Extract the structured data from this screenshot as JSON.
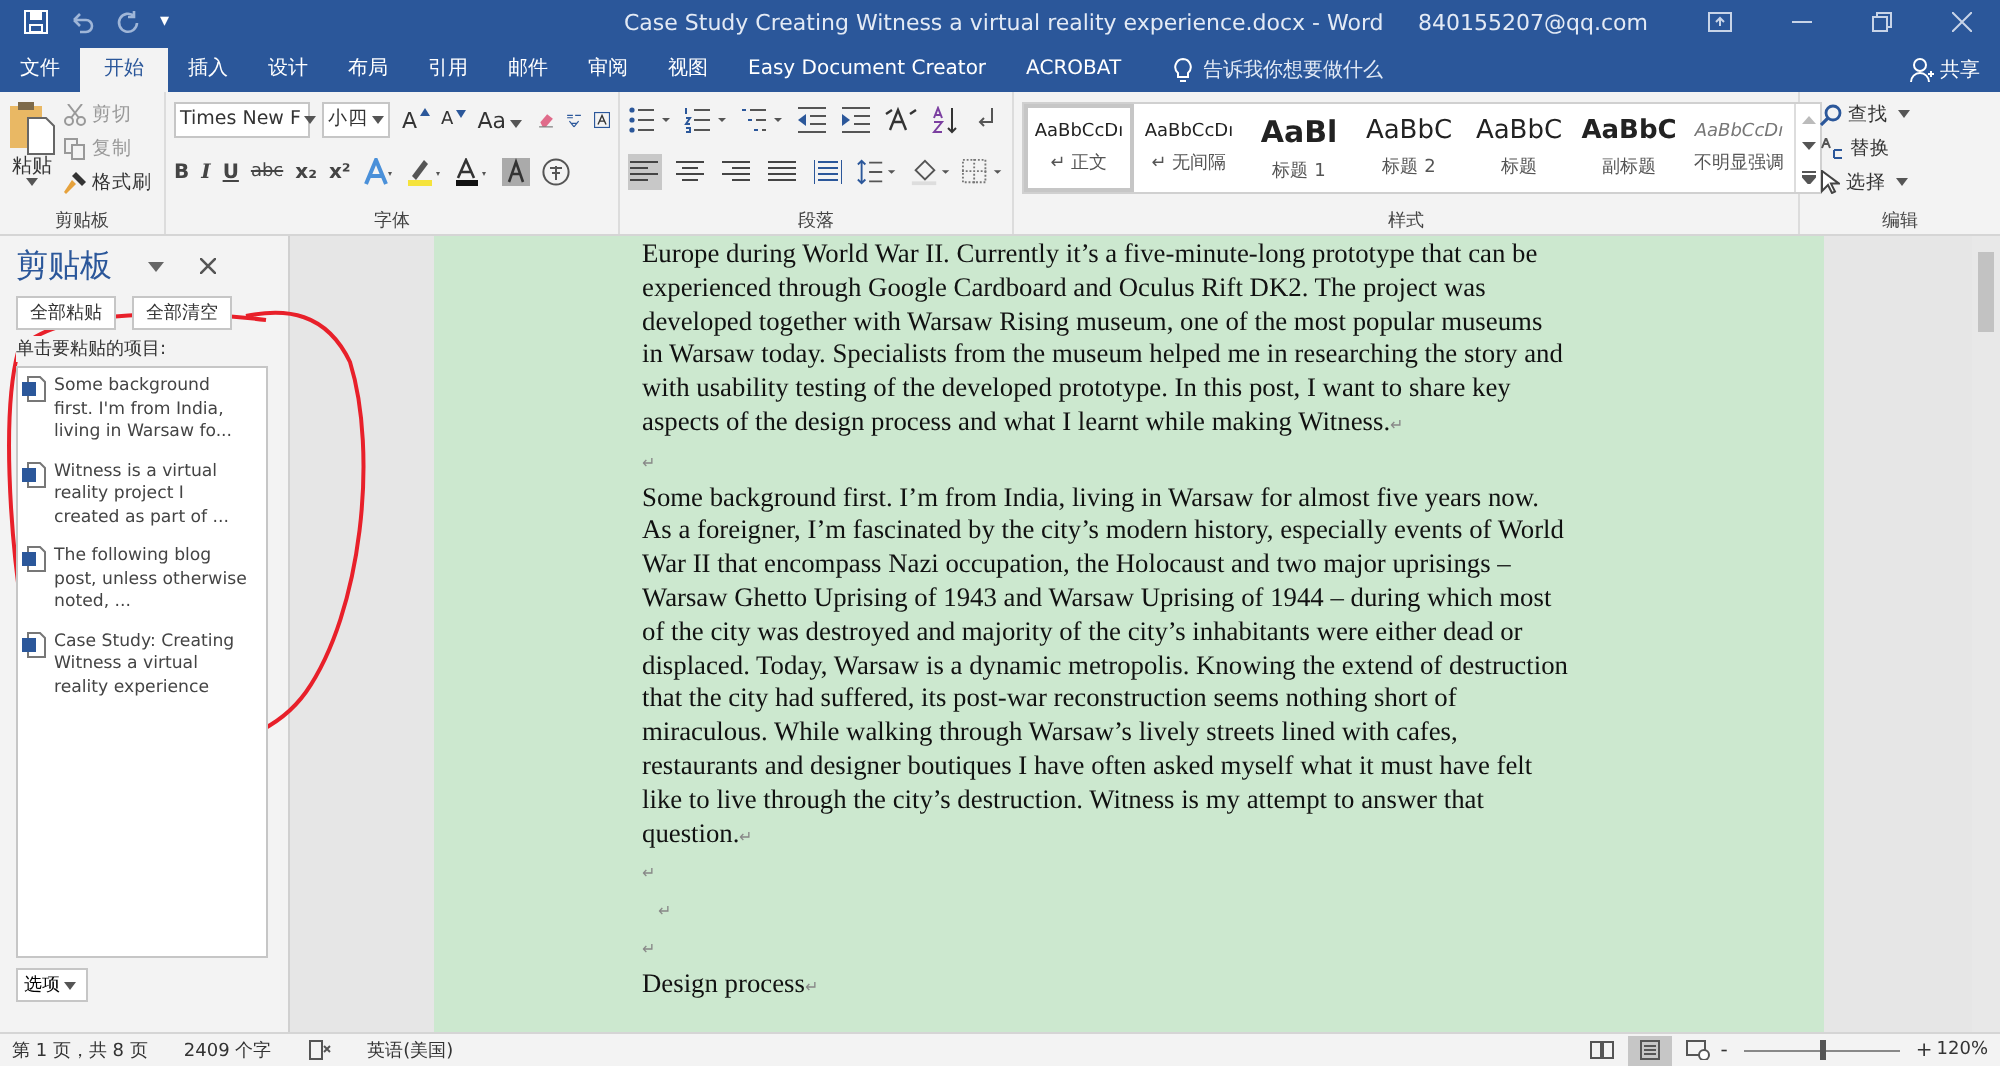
{
  "title_bar": {
    "title": "Case Study Creating Witness a virtual reality experience.docx  -  Word",
    "account": "840155207@qq.com",
    "customize": "▾"
  },
  "tabs": [
    {
      "label": "文件",
      "selected": false
    },
    {
      "label": "开始",
      "selected": true
    },
    {
      "label": "插入",
      "selected": false
    },
    {
      "label": "设计",
      "selected": false
    },
    {
      "label": "布局",
      "selected": false
    },
    {
      "label": "引用",
      "selected": false
    },
    {
      "label": "邮件",
      "selected": false
    },
    {
      "label": "审阅",
      "selected": false
    },
    {
      "label": "视图",
      "selected": false
    },
    {
      "label": "Easy Document Creator",
      "selected": false
    },
    {
      "label": "ACROBAT",
      "selected": false
    }
  ],
  "tell_me": {
    "placeholder": "告诉我你想要做什么"
  },
  "share": "共享",
  "ribbon": {
    "clipboard": {
      "paste": "粘贴",
      "cut": "剪切",
      "copy": "复制",
      "format_painter": "格式刷",
      "label": "剪贴板"
    },
    "font": {
      "font_name": "Times New F",
      "font_size": "小四",
      "grow": "A",
      "shrink": "A",
      "change_case": "Aa",
      "row2": [
        "B",
        "I",
        "U",
        "abc",
        "x₂",
        "x²"
      ],
      "label": "字体"
    },
    "paragraph": {
      "alignments": [
        {
          "kind": "left",
          "selected": true
        },
        {
          "kind": "center",
          "selected": false
        },
        {
          "kind": "right",
          "selected": false
        },
        {
          "kind": "justify",
          "selected": false
        },
        {
          "kind": "distribute",
          "selected": false
        }
      ],
      "label": "段落"
    },
    "styles": {
      "items": [
        {
          "preview": "AaBbCcDı",
          "name": "↵ 正文",
          "kind": "normal",
          "selected": true
        },
        {
          "preview": "AaBbCcDı",
          "name": "↵ 无间隔",
          "kind": "normal",
          "selected": false
        },
        {
          "preview": "AaBl",
          "name": "标题 1",
          "kind": "heading1",
          "selected": false
        },
        {
          "preview": "AaBbC",
          "name": "标题 2",
          "kind": "heading2",
          "selected": false
        },
        {
          "preview": "AaBbC",
          "name": "标题",
          "kind": "title",
          "selected": false
        },
        {
          "preview": "AaBbC",
          "name": "副标题",
          "kind": "subtitle",
          "selected": false
        },
        {
          "preview": "AaBbCcDı",
          "name": "不明显强调",
          "kind": "emphasis",
          "selected": false
        }
      ],
      "label": "样式"
    },
    "editing": {
      "find": "查找",
      "replace": "替换",
      "select": "选择",
      "label": "编辑"
    }
  },
  "clipboard_pane": {
    "title": "剪贴板",
    "paste_all": "全部粘贴",
    "clear_all": "全部清空",
    "hint": "单击要粘贴的项目:",
    "items": [
      "Some background first. I'm from India, living in Warsaw fo...",
      "Witness is a virtual reality project I created as part of ...",
      "The following blog post, unless otherwise noted, ...",
      "Case Study: Creating Witness a virtual reality experience"
    ],
    "options": "选项"
  },
  "document": {
    "paragraphs": [
      {
        "lines": [
          "Europe during World War II. Currently it’s a five-minute-long prototype that can be",
          "experienced through Google Cardboard and Oculus Rift DK2. The project was",
          "developed together with Warsaw Rising museum, one of the most popular museums",
          "in Warsaw today. Specialists from the museum helped me in researching the story and",
          "with usability testing of the developed prototype. In this post, I want to share key",
          "aspects of the design process and what I learnt while making Witness."
        ],
        "end_mark": "↵"
      },
      {
        "end_mark": "↵"
      },
      {
        "lines": [
          "Some background first. I’m from India, living in Warsaw for almost five years now.",
          "As a foreigner, I’m fascinated by the city’s modern history, especially events of World",
          "War II that encompass Nazi occupation, the Holocaust and two major uprisings –",
          "Warsaw Ghetto Uprising of 1943 and Warsaw Uprising of 1944 – during which most",
          "of the city was destroyed and majority of the city’s inhabitants were either dead or",
          "displaced. Today, Warsaw is a dynamic metropolis. Knowing the extend of destruction",
          "that the city had suffered, its post-war reconstruction seems nothing short of",
          "miraculous. While walking through Warsaw’s lively streets lined with cafes,",
          "restaurants and designer boutiques I have often asked myself what it must have felt",
          "like to live through the city’s destruction. Witness is my attempt to answer that",
          "question."
        ],
        "end_mark": "↵"
      },
      {
        "end_mark": "↵"
      },
      {
        "end_mark": "↵"
      },
      {
        "end_mark": "↵"
      },
      {
        "lines": [
          "Design process"
        ],
        "end_mark": "↵"
      }
    ]
  },
  "status_bar": {
    "page": "第 1 页，共 8 页",
    "words": "2409 个字",
    "language": "英语(美国)",
    "views": [
      {
        "kind": "read",
        "selected": false
      },
      {
        "kind": "print",
        "selected": true
      },
      {
        "kind": "web",
        "selected": false
      }
    ],
    "zoom_out": "-",
    "zoom_in": "+",
    "zoom": {
      "level": 0.5
    },
    "zoom_reading": "120%"
  }
}
